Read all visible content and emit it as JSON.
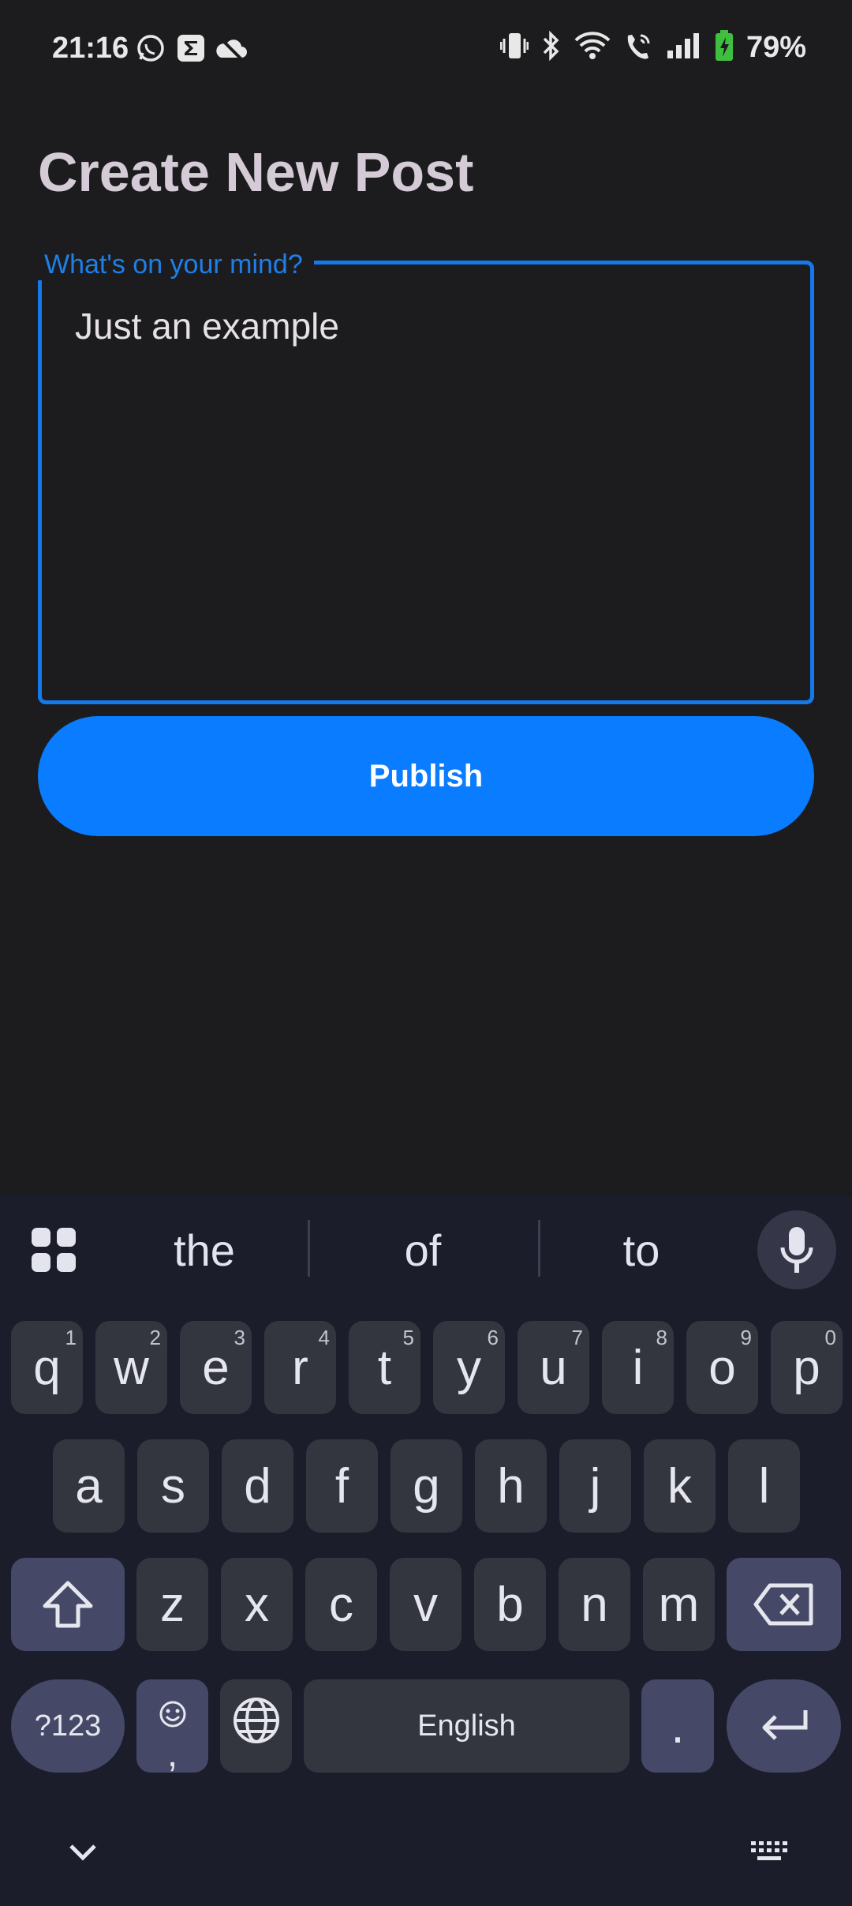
{
  "status_bar": {
    "time": "21:16",
    "left_icons": [
      "whatsapp-icon",
      "sigma-app-icon",
      "cloud-off-icon"
    ],
    "right_icons": [
      "vibrate-icon",
      "bluetooth-icon",
      "wifi-icon",
      "wifi-calling-icon",
      "signal-icon",
      "battery-charging-icon"
    ],
    "battery_percent": "79%"
  },
  "page": {
    "title": "Create New Post",
    "post_field": {
      "label": "What's on your mind?",
      "value": "Just an example"
    },
    "publish_label": "Publish"
  },
  "keyboard": {
    "suggestions": [
      "the",
      "of",
      "to"
    ],
    "row1": [
      {
        "key": "q",
        "hint": "1"
      },
      {
        "key": "w",
        "hint": "2"
      },
      {
        "key": "e",
        "hint": "3"
      },
      {
        "key": "r",
        "hint": "4"
      },
      {
        "key": "t",
        "hint": "5"
      },
      {
        "key": "y",
        "hint": "6"
      },
      {
        "key": "u",
        "hint": "7"
      },
      {
        "key": "i",
        "hint": "8"
      },
      {
        "key": "o",
        "hint": "9"
      },
      {
        "key": "p",
        "hint": "0"
      }
    ],
    "row2": [
      "a",
      "s",
      "d",
      "f",
      "g",
      "h",
      "j",
      "k",
      "l"
    ],
    "row3": [
      "z",
      "x",
      "c",
      "v",
      "b",
      "n",
      "m"
    ],
    "symbols_label": "?123",
    "comma_label": ",",
    "space_label": "English",
    "period_label": "."
  },
  "colors": {
    "accent": "#0a7cff",
    "field_border": "#1479ea",
    "background": "#1c1c1e",
    "keyboard_bg": "#1b1d2b"
  }
}
